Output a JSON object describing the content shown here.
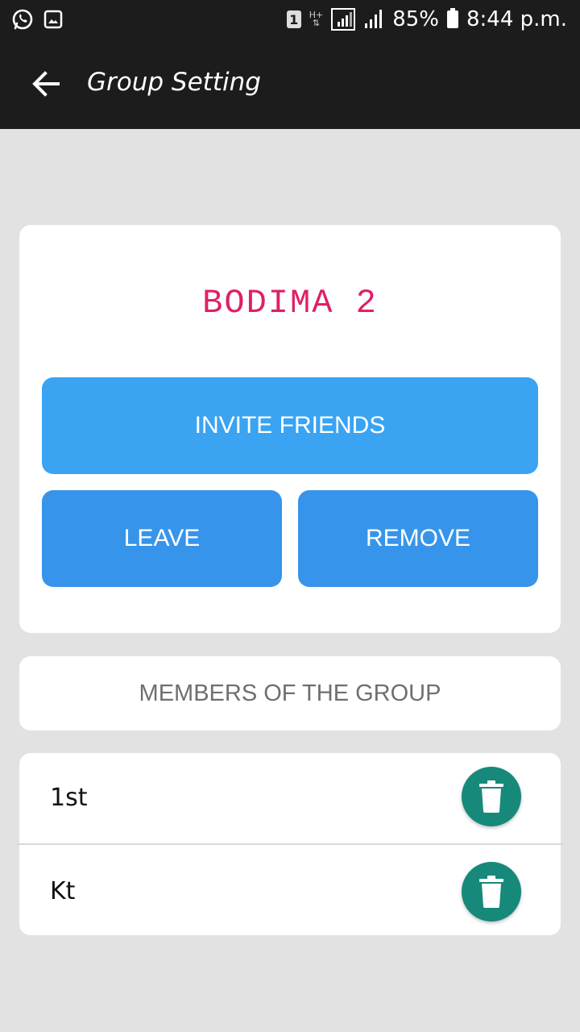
{
  "status_bar": {
    "sim_slot": "1",
    "network_type": "H+",
    "battery_percent": "85%",
    "time": "8:44 p.m.",
    "icons": [
      "whatsapp-icon",
      "image-icon",
      "signal-icon",
      "battery-icon"
    ]
  },
  "app_bar": {
    "title": "Group Setting",
    "back_icon": "arrow-back-icon"
  },
  "group": {
    "name": "BODIMA 2"
  },
  "actions": {
    "invite_label": "INVITE FRIENDS",
    "leave_label": "LEAVE",
    "remove_label": "REMOVE"
  },
  "members_section": {
    "title": "MEMBERS OF THE GROUP"
  },
  "members": [
    {
      "name": "1st",
      "action_icon": "trash-icon"
    },
    {
      "name": "Kt",
      "action_icon": "trash-icon"
    }
  ],
  "colors": {
    "app_bar": "#1c1c1c",
    "background": "#e2e2e2",
    "group_name": "#e01f68",
    "invite_button": "#3aa3f2",
    "action_button": "#3695ea",
    "delete_button": "#16897a"
  }
}
